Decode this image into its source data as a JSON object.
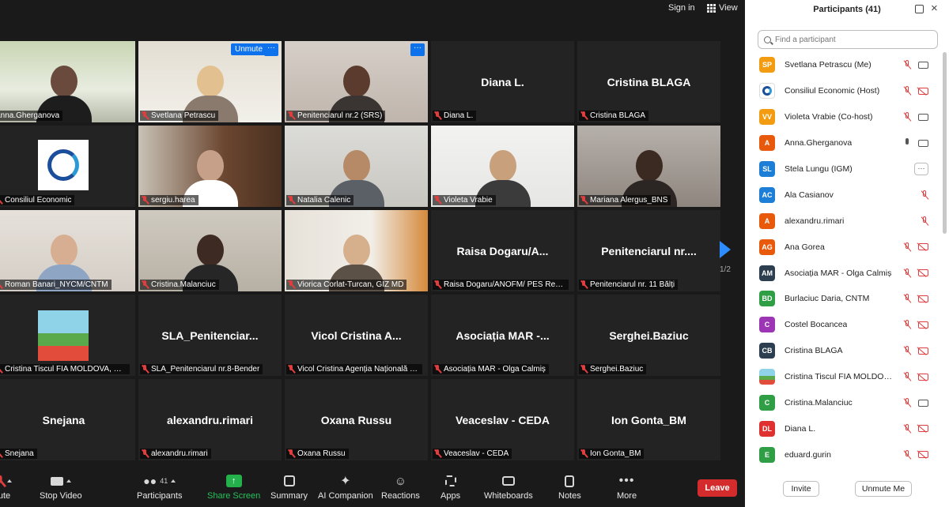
{
  "topbar": {
    "sign_in": "Sign in",
    "view": "View"
  },
  "tiles": [
    {
      "label": "Anna.Gherganova",
      "display": "",
      "video": "woman-dark",
      "active": true
    },
    {
      "label": "Svetlana Petrascu",
      "display": "",
      "video": "woman-light",
      "unmute": "Unmute",
      "more": "···"
    },
    {
      "label": "Penitenciarul nr.2 (SRS)",
      "display": "",
      "video": "woman-dark2",
      "more": "···"
    },
    {
      "label": "Diana L.",
      "display": "Diana L."
    },
    {
      "label": "Cristina BLAGA",
      "display": "Cristina BLAGA"
    },
    {
      "label": "Consiliul Economic",
      "display": "",
      "video": "logo"
    },
    {
      "label": "sergiu.harea",
      "display": "",
      "video": "man-office"
    },
    {
      "label": "Natalia Calenic",
      "display": "",
      "video": "woman-glasses"
    },
    {
      "label": "Violeta Vrabie",
      "display": "",
      "video": "woman-headset"
    },
    {
      "label": "Mariana Alergus_BNS",
      "display": "",
      "video": "woman-headset-dark"
    },
    {
      "label": "Roman Banari_NYCM/CNTM",
      "display": "",
      "video": "man-face"
    },
    {
      "label": "Cristina.Malanciuc",
      "display": "",
      "video": "woman-room"
    },
    {
      "label": "Viorica Corlat-Turcan, GIZ MD",
      "display": "",
      "video": "woman-art"
    },
    {
      "label": "Raisa Dogaru/ANOFM/ PES Repu...",
      "display": "Raisa  Dogaru/A..."
    },
    {
      "label": "Penitenciarul nr. 11 Bălți",
      "display": "Penitenciarul  nr...."
    },
    {
      "label": "Cristina Tiscul FIA MOLDOVA, Chiș...",
      "display": "",
      "video": "painting"
    },
    {
      "label": "SLA_Penitenciarul nr.8-Bender",
      "display": "SLA_Penitenciar..."
    },
    {
      "label": "Vicol Cristina Agenția Națională Tr...",
      "display": "Vicol  Cristina  A..."
    },
    {
      "label": "Asociația MAR - Olga Calmiș",
      "display": "Asociația  MAR  -..."
    },
    {
      "label": "Serghei.Baziuc",
      "display": "Serghei.Baziuc"
    },
    {
      "label": "Snejana",
      "display": "Snejana"
    },
    {
      "label": "alexandru.rimari",
      "display": "alexandru.rimari"
    },
    {
      "label": "Oxana Russu",
      "display": "Oxana Russu"
    },
    {
      "label": "Veaceslav - CEDA",
      "display": "Veaceslav  -  CEDA"
    },
    {
      "label": "Ion Gonta_BM",
      "display": "Ion Gonta_BM"
    }
  ],
  "pager": {
    "indicator": "1/2"
  },
  "toolbar": {
    "mute": "ute",
    "stop_video": "Stop Video",
    "participants": "Participants",
    "participants_count": "41",
    "share_screen": "Share Screen",
    "summary": "Summary",
    "ai_companion": "AI Companion",
    "reactions": "Reactions",
    "apps": "Apps",
    "whiteboards": "Whiteboards",
    "notes": "Notes",
    "more": "More",
    "leave": "Leave"
  },
  "panel": {
    "title": "Participants (41)",
    "search_placeholder": "Find a participant",
    "invite": "Invite",
    "unmute_me": "Unmute Me",
    "participants": [
      {
        "initials": "SP",
        "color": "#f39c12",
        "name": "Svetlana Petrascu (Me)",
        "mic": "off",
        "cam": "on"
      },
      {
        "initials": "",
        "color": "#ffffff",
        "name": "Consiliul Economic (Host)",
        "mic": "off",
        "cam": "off",
        "logo": true
      },
      {
        "initials": "VV",
        "color": "#f39c12",
        "name": "Violeta Vrabie (Co-host)",
        "mic": "off",
        "cam": "on"
      },
      {
        "initials": "A",
        "color": "#e8590c",
        "name": "Anna.Gherganova",
        "mic": "on",
        "cam": "on"
      },
      {
        "initials": "SL",
        "color": "#1c7ed6",
        "name": "Stela Lungu (IGM)",
        "more": "···"
      },
      {
        "initials": "AC",
        "color": "#1c7ed6",
        "name": "Ala Casianov",
        "mic": "off"
      },
      {
        "initials": "A",
        "color": "#e8590c",
        "name": "alexandru.rimari",
        "mic": "off"
      },
      {
        "initials": "AG",
        "color": "#e8590c",
        "name": "Ana Gorea",
        "mic": "off",
        "cam": "off"
      },
      {
        "initials": "AM",
        "color": "#2c3e50",
        "name": "Asociația MAR - Olga Calmiș",
        "mic": "off",
        "cam": "off"
      },
      {
        "initials": "BD",
        "color": "#2f9e44",
        "name": "Burlaciuc Daria, CNTM",
        "mic": "off",
        "cam": "off"
      },
      {
        "initials": "C",
        "color": "#9c36b5",
        "name": "Costel Bocancea",
        "mic": "off",
        "cam": "off"
      },
      {
        "initials": "CB",
        "color": "#2c3e50",
        "name": "Cristina BLAGA",
        "mic": "off",
        "cam": "off"
      },
      {
        "initials": "",
        "color": "#6db3d6",
        "name": "Cristina Tiscul FIA MOLDOVA, C...",
        "mic": "off",
        "cam": "off",
        "painting": true
      },
      {
        "initials": "C",
        "color": "#2f9e44",
        "name": "Cristina.Malanciuc",
        "mic": "off",
        "cam": "on"
      },
      {
        "initials": "DL",
        "color": "#e03131",
        "name": "Diana L.",
        "mic": "off",
        "cam": "off"
      },
      {
        "initials": "E",
        "color": "#2f9e44",
        "name": "eduard.gurin",
        "mic": "off",
        "cam": "off"
      }
    ]
  }
}
